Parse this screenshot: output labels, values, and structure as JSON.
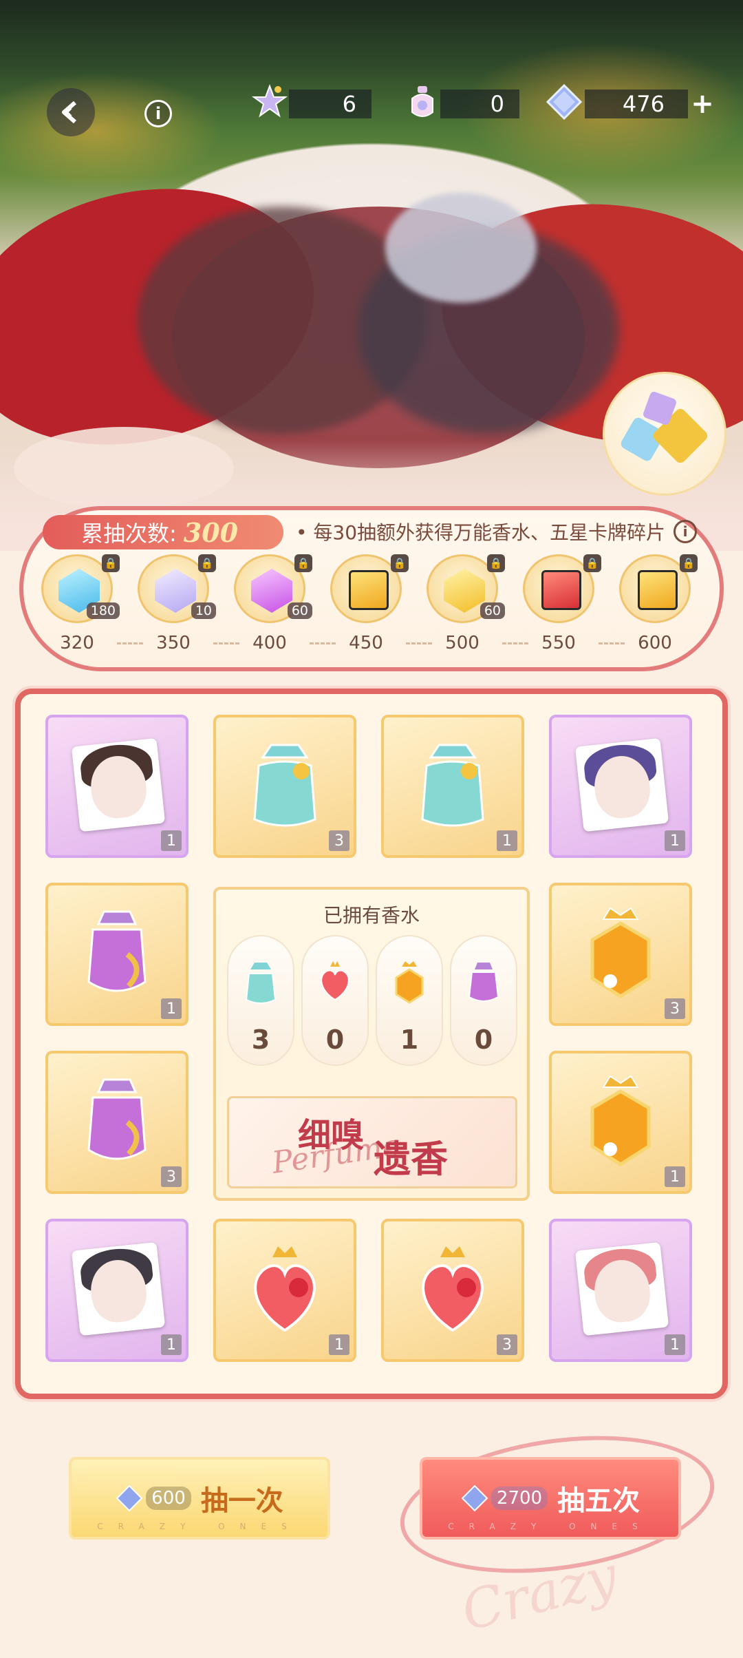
{
  "resources": {
    "star_ticket": "6",
    "perfume_ticket": "0",
    "diamonds": "476",
    "add_symbol": "+"
  },
  "track": {
    "label": "累抽次数:",
    "count": "300",
    "note": "• 每30抽额外获得万能香水、五星卡牌碎片",
    "milestones": [
      {
        "threshold": "320",
        "reward_icon": "blue-gem-icon",
        "count": "180",
        "locked": true
      },
      {
        "threshold": "350",
        "reward_icon": "lavender-gem-icon",
        "count": "10",
        "locked": true
      },
      {
        "threshold": "400",
        "reward_icon": "pink-gem-icon",
        "count": "60",
        "locked": true
      },
      {
        "threshold": "450",
        "reward_icon": "gold-box-icon",
        "count": "",
        "locked": true
      },
      {
        "threshold": "500",
        "reward_icon": "gold-gem-icon",
        "count": "60",
        "locked": true
      },
      {
        "threshold": "550",
        "reward_icon": "red-box-icon",
        "count": "",
        "locked": true
      },
      {
        "threshold": "600",
        "reward_icon": "gold-box-icon",
        "count": "",
        "locked": true
      }
    ]
  },
  "grid": {
    "cells": [
      {
        "kind": "card",
        "qty": "1"
      },
      {
        "kind": "teal-perfume",
        "qty": "3"
      },
      {
        "kind": "teal-perfume",
        "qty": "1"
      },
      {
        "kind": "card",
        "qty": "1"
      },
      {
        "kind": "purple-perfume",
        "qty": "1"
      },
      {
        "kind": "gold-perfume",
        "qty": "3"
      },
      {
        "kind": "purple-perfume",
        "qty": "3"
      },
      {
        "kind": "gold-perfume",
        "qty": "1"
      },
      {
        "kind": "card",
        "qty": "1"
      },
      {
        "kind": "red-perfume",
        "qty": "1"
      },
      {
        "kind": "red-perfume",
        "qty": "3"
      },
      {
        "kind": "card",
        "qty": "1"
      }
    ]
  },
  "owned": {
    "title": "已拥有香水",
    "items": [
      {
        "icon": "teal-perfume-icon",
        "count": "3"
      },
      {
        "icon": "red-perfume-icon",
        "count": "0"
      },
      {
        "icon": "gold-perfume-icon",
        "count": "1"
      },
      {
        "icon": "purple-perfume-icon",
        "count": "0"
      }
    ],
    "banner_title_1": "细嗅",
    "banner_title_2": "遗香",
    "banner_script": "Perfume"
  },
  "buttons": {
    "draw_one": {
      "cost": "600",
      "label": "抽一次",
      "subtext": "CRAZY ONES"
    },
    "draw_five": {
      "cost": "2700",
      "label": "抽五次",
      "subtext": "CRAZY ONES"
    }
  },
  "colors": {
    "accent_red": "#e06762",
    "gold": "#f9d48b",
    "purple": "#e2b5ee"
  }
}
